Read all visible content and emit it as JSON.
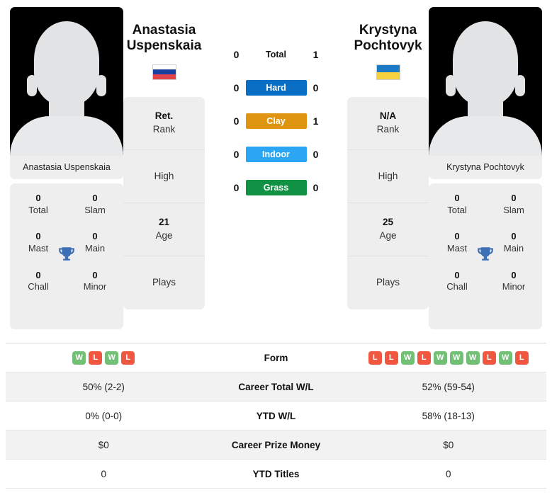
{
  "players": {
    "left": {
      "first_name": "Anastasia",
      "last_name": "Uspenskaia",
      "caption": "Anastasia Uspenskaia",
      "flag": {
        "name": "russia-flag",
        "bands": [
          "#ffffff",
          "#1b3fa0",
          "#e1444a"
        ]
      },
      "titles": {
        "total": {
          "value": "0",
          "label": "Total"
        },
        "slam": {
          "value": "0",
          "label": "Slam"
        },
        "mast": {
          "value": "0",
          "label": "Mast"
        },
        "main": {
          "value": "0",
          "label": "Main"
        },
        "chall": {
          "value": "0",
          "label": "Chall"
        },
        "minor": {
          "value": "0",
          "label": "Minor"
        }
      },
      "info": {
        "rank_value": "Ret.",
        "rank_label": "Rank",
        "high_label": "High",
        "high_value": "",
        "age_value": "21",
        "age_label": "Age",
        "plays_label": "Plays",
        "plays_value": ""
      }
    },
    "right": {
      "first_name": "Krystyna",
      "last_name": "Pochtovyk",
      "caption": "Krystyna Pochtovyk",
      "flag": {
        "name": "ukraine-flag",
        "bands": [
          "#1b7ac6",
          "#1b7ac6",
          "#f4d13d"
        ]
      },
      "titles": {
        "total": {
          "value": "0",
          "label": "Total"
        },
        "slam": {
          "value": "0",
          "label": "Slam"
        },
        "mast": {
          "value": "0",
          "label": "Mast"
        },
        "main": {
          "value": "0",
          "label": "Main"
        },
        "chall": {
          "value": "0",
          "label": "Chall"
        },
        "minor": {
          "value": "0",
          "label": "Minor"
        }
      },
      "info": {
        "rank_value": "N/A",
        "rank_label": "Rank",
        "high_label": "High",
        "high_value": "",
        "age_value": "25",
        "age_label": "Age",
        "plays_label": "Plays",
        "plays_value": ""
      }
    }
  },
  "head_to_head": [
    {
      "label": "Total",
      "left": "0",
      "right": "1",
      "color": "none"
    },
    {
      "label": "Hard",
      "left": "0",
      "right": "0",
      "color": "#0a6ec4"
    },
    {
      "label": "Clay",
      "left": "0",
      "right": "1",
      "color": "#e09512"
    },
    {
      "label": "Indoor",
      "left": "0",
      "right": "0",
      "color": "#2ba6f5"
    },
    {
      "label": "Grass",
      "left": "0",
      "right": "0",
      "color": "#119144"
    }
  ],
  "stats_table": {
    "form": {
      "label": "Form",
      "left": [
        "W",
        "L",
        "W",
        "L"
      ],
      "right": [
        "L",
        "L",
        "W",
        "L",
        "W",
        "W",
        "W",
        "L",
        "W",
        "L"
      ]
    },
    "rows": [
      {
        "label": "Career Total W/L",
        "left": "50% (2-2)",
        "right": "52% (59-54)"
      },
      {
        "label": "YTD W/L",
        "left": "0% (0-0)",
        "right": "58% (18-13)"
      },
      {
        "label": "Career Prize Money",
        "left": "$0",
        "right": "$0"
      },
      {
        "label": "YTD Titles",
        "left": "0",
        "right": "0"
      }
    ]
  },
  "icons": {
    "trophy": "trophy-icon"
  }
}
